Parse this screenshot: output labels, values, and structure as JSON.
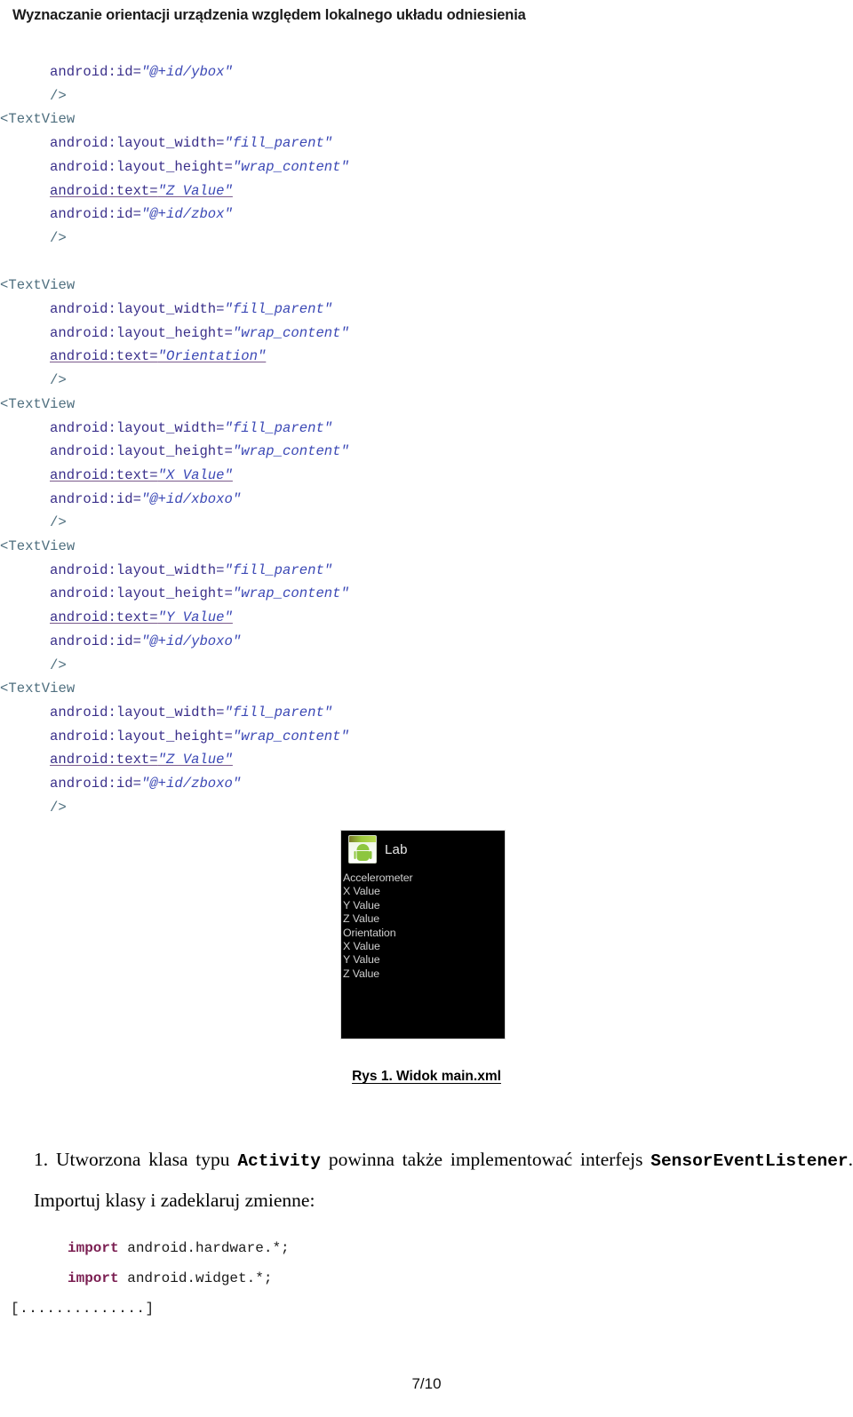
{
  "header": {
    "title": "Wyznaczanie orientacji urządzenia względem lokalnego układu odniesienia"
  },
  "colors": {
    "tag": "#4f6f7f",
    "attribute": "#3a2f8a",
    "value": "#3b48b5",
    "keyword": "#7b1f52",
    "underline": "#7a5a8c",
    "emulator_background": "#000000",
    "emulator_text": "#cfcfcf",
    "android_green": "#8dc63f"
  },
  "xml_code": {
    "lines": [
      {
        "indent": 1,
        "parts": [
          {
            "t": "android:id=",
            "c": "attr"
          },
          {
            "t": "\"@+id/ybox\"",
            "c": "val"
          }
        ]
      },
      {
        "indent": 1,
        "parts": [
          {
            "t": "/>",
            "c": "tag"
          }
        ]
      },
      {
        "indent": 0,
        "parts": [
          {
            "t": "<TextView",
            "c": "tag"
          }
        ]
      },
      {
        "indent": 1,
        "parts": [
          {
            "t": "android:layout_width=",
            "c": "attr"
          },
          {
            "t": "\"fill_parent\"",
            "c": "val"
          }
        ]
      },
      {
        "indent": 1,
        "parts": [
          {
            "t": "android:layout_height=",
            "c": "attr"
          },
          {
            "t": "\"wrap_content\"",
            "c": "val"
          }
        ]
      },
      {
        "indent": 1,
        "underline": true,
        "parts": [
          {
            "t": "android:text=",
            "c": "attr"
          },
          {
            "t": "\"Z Value\"",
            "c": "val"
          }
        ]
      },
      {
        "indent": 1,
        "parts": [
          {
            "t": "android:id=",
            "c": "attr"
          },
          {
            "t": "\"@+id/zbox\"",
            "c": "val"
          }
        ]
      },
      {
        "indent": 1,
        "parts": [
          {
            "t": "/>",
            "c": "tag"
          }
        ]
      },
      {
        "indent": 0,
        "parts": [
          {
            "t": "",
            "c": "tag"
          }
        ]
      },
      {
        "indent": 0,
        "parts": [
          {
            "t": "<TextView",
            "c": "tag"
          }
        ]
      },
      {
        "indent": 1,
        "parts": [
          {
            "t": "android:layout_width=",
            "c": "attr"
          },
          {
            "t": "\"fill_parent\"",
            "c": "val"
          }
        ]
      },
      {
        "indent": 1,
        "parts": [
          {
            "t": "android:layout_height=",
            "c": "attr"
          },
          {
            "t": "\"wrap_content\"",
            "c": "val"
          }
        ]
      },
      {
        "indent": 1,
        "underline": true,
        "parts": [
          {
            "t": "android:text=",
            "c": "attr"
          },
          {
            "t": "\"Orientation\"",
            "c": "val"
          }
        ]
      },
      {
        "indent": 1,
        "parts": [
          {
            "t": "/>",
            "c": "tag"
          }
        ]
      },
      {
        "indent": 0,
        "parts": [
          {
            "t": "<TextView",
            "c": "tag"
          }
        ]
      },
      {
        "indent": 1,
        "parts": [
          {
            "t": "android:layout_width=",
            "c": "attr"
          },
          {
            "t": "\"fill_parent\"",
            "c": "val"
          }
        ]
      },
      {
        "indent": 1,
        "parts": [
          {
            "t": "android:layout_height=",
            "c": "attr"
          },
          {
            "t": "\"wrap_content\"",
            "c": "val"
          }
        ]
      },
      {
        "indent": 1,
        "underline": true,
        "parts": [
          {
            "t": "android:text=",
            "c": "attr"
          },
          {
            "t": "\"X Value\"",
            "c": "val"
          }
        ]
      },
      {
        "indent": 1,
        "parts": [
          {
            "t": "android:id=",
            "c": "attr"
          },
          {
            "t": "\"@+id/xboxo\"",
            "c": "val"
          }
        ]
      },
      {
        "indent": 1,
        "parts": [
          {
            "t": "/>",
            "c": "tag"
          }
        ]
      },
      {
        "indent": 0,
        "parts": [
          {
            "t": "<TextView",
            "c": "tag"
          }
        ]
      },
      {
        "indent": 1,
        "parts": [
          {
            "t": "android:layout_width=",
            "c": "attr"
          },
          {
            "t": "\"fill_parent\"",
            "c": "val"
          }
        ]
      },
      {
        "indent": 1,
        "parts": [
          {
            "t": "android:layout_height=",
            "c": "attr"
          },
          {
            "t": "\"wrap_content\"",
            "c": "val"
          }
        ]
      },
      {
        "indent": 1,
        "underline": true,
        "parts": [
          {
            "t": "android:text=",
            "c": "attr"
          },
          {
            "t": "\"Y Value\"",
            "c": "val"
          }
        ]
      },
      {
        "indent": 1,
        "parts": [
          {
            "t": "android:id=",
            "c": "attr"
          },
          {
            "t": "\"@+id/yboxo\"",
            "c": "val"
          }
        ]
      },
      {
        "indent": 1,
        "parts": [
          {
            "t": "/>",
            "c": "tag"
          }
        ]
      },
      {
        "indent": 0,
        "parts": [
          {
            "t": "<TextView",
            "c": "tag"
          }
        ]
      },
      {
        "indent": 1,
        "parts": [
          {
            "t": "android:layout_width=",
            "c": "attr"
          },
          {
            "t": "\"fill_parent\"",
            "c": "val"
          }
        ]
      },
      {
        "indent": 1,
        "parts": [
          {
            "t": "android:layout_height=",
            "c": "attr"
          },
          {
            "t": "\"wrap_content\"",
            "c": "val"
          }
        ]
      },
      {
        "indent": 1,
        "underline": true,
        "parts": [
          {
            "t": "android:text=",
            "c": "attr"
          },
          {
            "t": "\"Z Value\"",
            "c": "val"
          }
        ]
      },
      {
        "indent": 1,
        "parts": [
          {
            "t": "android:id=",
            "c": "attr"
          },
          {
            "t": "\"@+id/zboxo\"",
            "c": "val"
          }
        ]
      },
      {
        "indent": 1,
        "parts": [
          {
            "t": "/>",
            "c": "tag"
          }
        ]
      }
    ]
  },
  "emulator": {
    "app_title": "Lab",
    "icon_name": "android-app-icon",
    "list": [
      "Accelerometer",
      "X Value",
      "Y Value",
      "Z Value",
      "Orientation",
      "X Value",
      "Y Value",
      "Z Value"
    ]
  },
  "figure": {
    "caption": "Rys 1. Widok main.xml"
  },
  "numbered_item": {
    "marker": "1.",
    "text_part1": "Utworzona klasa typu",
    "code1": "Activity",
    "text_part2": "powinna także implementować interfejs",
    "code2": "SensorEventListener",
    "text_part3": ". Importuj klasy i zadeklaruj zmienne:"
  },
  "import_block": {
    "lines": [
      {
        "keyword": "import",
        "rest": " android.hardware.*;"
      },
      {
        "keyword": "import",
        "rest": " android.widget.*;"
      }
    ]
  },
  "ellipsis": {
    "text": "[..............]"
  },
  "footer": {
    "page": "7/10"
  }
}
